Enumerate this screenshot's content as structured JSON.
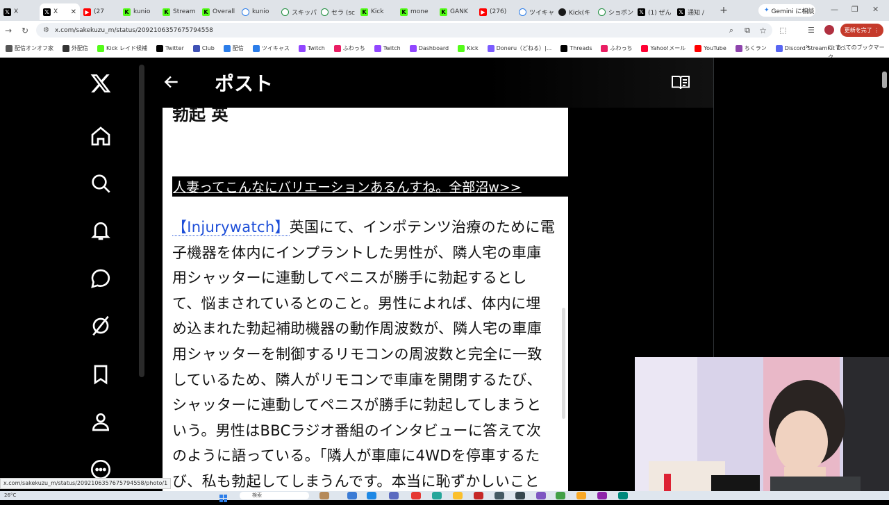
{
  "browser": {
    "tabs": [
      {
        "label": "X",
        "icon": "x"
      },
      {
        "label": "X",
        "icon": "x",
        "active": true
      },
      {
        "label": "(27",
        "icon": "yt"
      },
      {
        "label": "kunio",
        "icon": "k"
      },
      {
        "label": "Stream",
        "icon": "k"
      },
      {
        "label": "Overall",
        "icon": "k"
      },
      {
        "label": "kunio",
        "icon": "tw"
      },
      {
        "label": "スキッパ",
        "icon": "sw"
      },
      {
        "label": "セラ (sc",
        "icon": "sw"
      },
      {
        "label": "Kick",
        "icon": "k"
      },
      {
        "label": "mone",
        "icon": "k"
      },
      {
        "label": "GANK",
        "icon": "k"
      },
      {
        "label": "(276) ",
        "icon": "yt"
      },
      {
        "label": "ツイキャ",
        "icon": "tw"
      },
      {
        "label": "Kick(キ",
        "icon": "kd"
      },
      {
        "label": "ショボン",
        "icon": "sw"
      },
      {
        "label": "(1) ぜん",
        "icon": "x"
      },
      {
        "label": "通知 /",
        "icon": "x"
      }
    ],
    "gemini_label": "Gemini に相談",
    "url": "x.com/sakekuzu_m/status/2092106357675794558",
    "update_button": "更新を完了",
    "bookmarks": [
      "配信オンオフ家",
      "外配信",
      "Kick レイド候補",
      "Twitter",
      "Club",
      "配信",
      "ツイキャス",
      "Twitch",
      "ふわっち",
      "Twitch",
      "Dashboard",
      "Kick",
      "Doneru（どねる）|...",
      "Threads",
      "ふわっち",
      "Yahoo!メール",
      "YouTube",
      "ちくラン",
      "Discord StreamKit O..."
    ],
    "bookmarks_folder": "すべてのブックマーク",
    "status_url": "x.com/sakekuzu_m/status/2092106357675794558/photo/1"
  },
  "x": {
    "header_title": "ポスト"
  },
  "article": {
    "partial_heading": "勃起 英",
    "banner_link": "人妻ってこんなにバリエーションあるんすね。全部沼w>>",
    "source_label": "【Injurywatch】",
    "lines": [
      "英国にて、インポテンツ治療のために電",
      "子機器を体内にインプラントした男性が、隣人宅の車庫",
      "用シャッターに連動してペニスが勝手に勃起するとし",
      "て、悩まされているとのこと。男性によれば、体内に埋",
      "め込まれた勃起補助機器の動作周波数が、隣人宅の車庫",
      "用シャッターを制御するリモコンの周波数と完全に一致",
      "しているため、隣人がリモコンで車庫を開閉するたび、",
      "シャッターに連動してペニスが勝手に勃起してしまうと",
      "いう。男性はBBCラジオ番組のインタビューに答えて次",
      "のように語っている。「隣人が車庫に4WDを停車するた",
      "び、私も勃起してしまうんです。本当に恥ずかしいこと"
    ]
  },
  "taskbar": {
    "temperature": "26°C",
    "search_placeholder": "検索"
  }
}
